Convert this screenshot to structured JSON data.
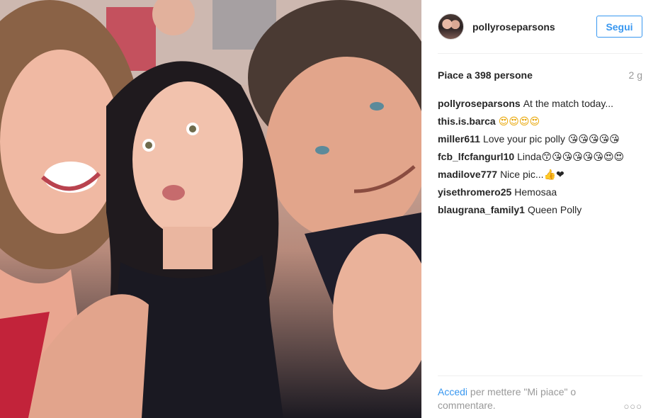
{
  "header": {
    "username": "pollyroseparsons",
    "follow_label": "Segui"
  },
  "likes": {
    "text": "Piace a 398 persone",
    "age": "2 g"
  },
  "comments": [
    {
      "user": "pollyroseparsons",
      "text": "At the match today..."
    },
    {
      "user": "this.is.barca",
      "text": "😍😍😍😍"
    },
    {
      "user": "miller611",
      "text": "Love your pic polly 😘😘😘😘😘"
    },
    {
      "user": "fcb_lfcfangurl10",
      "text": "Linda😙😘😘😘😘😘😍😍"
    },
    {
      "user": "madilove777",
      "text": "Nice pic...👍❤"
    },
    {
      "user": "yisethromero25",
      "text": "Hemosaa"
    },
    {
      "user": "blaugrana_family1",
      "text": "Queen Polly"
    }
  ],
  "footer": {
    "login_link": "Accedi",
    "login_rest": " per mettere \"Mi piace\" o commentare.",
    "more_label": "○○○"
  },
  "colors": {
    "link": "#3897f0",
    "muted": "#999999",
    "text": "#262626"
  }
}
